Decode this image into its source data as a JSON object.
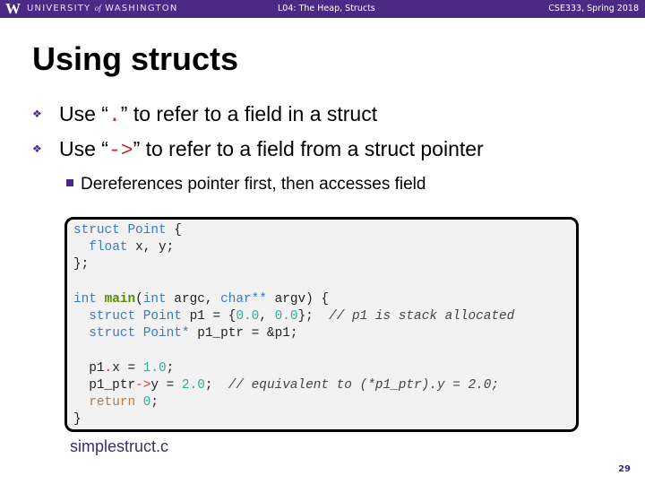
{
  "header": {
    "logo": "W",
    "university_prefix": "UNIVERSITY",
    "university_of": "of",
    "university_suffix": "WASHINGTON",
    "lecture": "L04: The Heap, Structs",
    "course": "CSE333, Spring 2018"
  },
  "slide": {
    "title": "Using structs",
    "bullets": [
      {
        "icon": "diamond-bullet-icon",
        "before": "Use “",
        "code": ".",
        "after": "” to refer to a field in a struct"
      },
      {
        "icon": "diamond-bullet-icon",
        "before": "Use “",
        "code": "->",
        "after": "” to refer to a field from a struct pointer"
      }
    ],
    "sub_bullets": [
      {
        "icon": "square-bullet-icon",
        "text": "Dereferences pointer first, then accesses field"
      }
    ],
    "code_lines": [
      "struct Point {",
      "  float x, y;",
      "};",
      "",
      "int main(int argc, char** argv) {",
      "  struct Point p1 = {0.0, 0.0};  // p1 is stack allocated",
      "  struct Point* p1_ptr = &p1;",
      "",
      "  p1.x = 1.0;",
      "  p1_ptr->y = 2.0;  // equivalent to (*p1_ptr).y = 2.0;",
      "  return 0;",
      "}"
    ],
    "filename": "simplestruct.c",
    "page_number": "29"
  },
  "colors": {
    "brand_purple": "#4b2a85",
    "keyword_blue": "#3a7bbf",
    "function_green": "#5c8a00",
    "number_teal": "#2ab09a",
    "operator_red": "#d9332b",
    "code_background": "#f2f2f2"
  }
}
